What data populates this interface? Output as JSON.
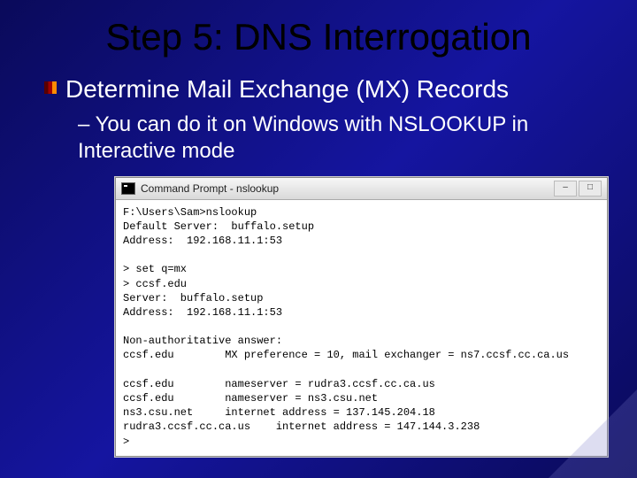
{
  "slide": {
    "title": "Step 5: DNS Interrogation",
    "bullet1": "Determine Mail Exchange (MX) Records",
    "sub1": "– You can do it on Windows with NSLOOKUP in Interactive mode"
  },
  "cmd": {
    "window_title": "Command Prompt - nslookup",
    "lines": [
      "F:\\Users\\Sam>nslookup",
      "Default Server:  buffalo.setup",
      "Address:  192.168.11.1:53",
      "",
      "> set q=mx",
      "> ccsf.edu",
      "Server:  buffalo.setup",
      "Address:  192.168.11.1:53",
      "",
      "Non-authoritative answer:",
      "ccsf.edu        MX preference = 10, mail exchanger = ns7.ccsf.cc.ca.us",
      "",
      "ccsf.edu        nameserver = rudra3.ccsf.cc.ca.us",
      "ccsf.edu        nameserver = ns3.csu.net",
      "ns3.csu.net     internet address = 137.145.204.18",
      "rudra3.ccsf.cc.ca.us    internet address = 147.144.3.238",
      ">"
    ]
  }
}
